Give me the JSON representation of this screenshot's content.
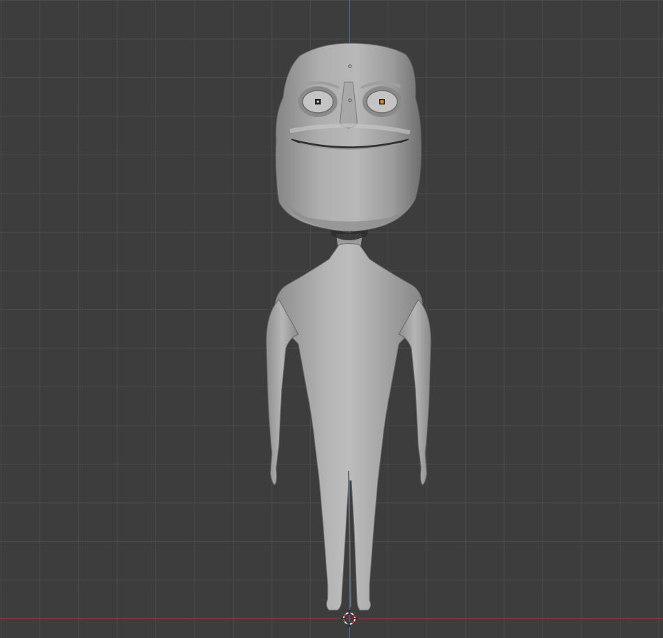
{
  "viewport": {
    "background": "#3d3d3d",
    "grid_color": "#4a4a4a",
    "axis_x_color": "#a33b3b",
    "axis_z_color": "#2f6db5",
    "object": "mesh-character",
    "origin_marker": "orange"
  }
}
